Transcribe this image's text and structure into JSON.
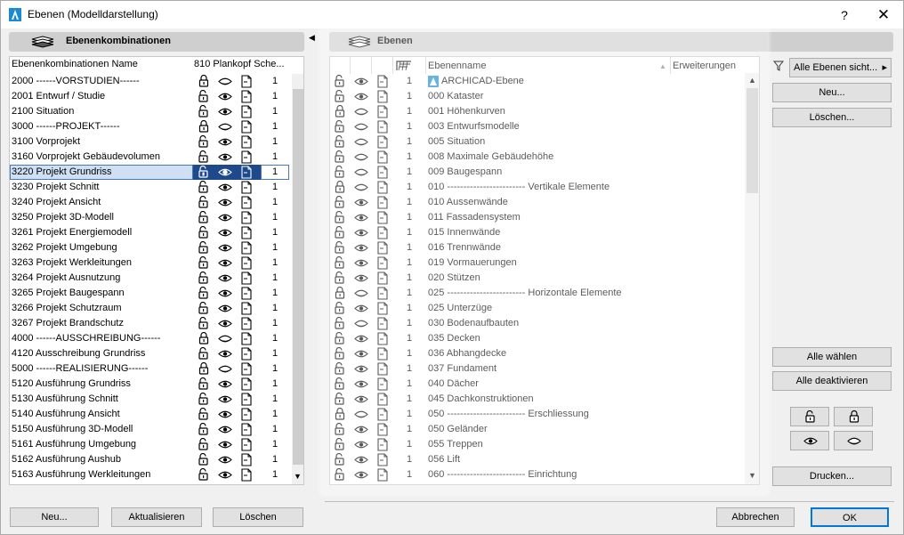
{
  "window": {
    "title": "Ebenen (Modelldarstellung)",
    "help_label": "?",
    "close_label": "✕"
  },
  "left": {
    "header": "Ebenenkombinationen",
    "col_name": "Ebenenkombinationen Name",
    "col_810": "810 Plankopf Sche...",
    "rows": [
      {
        "name": "2000 ------VORSTUDIEN------",
        "lock": "locked",
        "eye": "hidden",
        "count": "1"
      },
      {
        "name": "2001 Entwurf / Studie",
        "lock": "unlocked",
        "eye": "visible",
        "count": "1"
      },
      {
        "name": "2100 Situation",
        "lock": "unlocked",
        "eye": "visible",
        "count": "1"
      },
      {
        "name": "3000 ------PROJEKT------",
        "lock": "locked",
        "eye": "hidden",
        "count": "1"
      },
      {
        "name": "3100 Vorprojekt",
        "lock": "unlocked",
        "eye": "visible",
        "count": "1"
      },
      {
        "name": "3160 Vorprojekt Gebäudevolumen",
        "lock": "unlocked",
        "eye": "visible",
        "count": "1"
      },
      {
        "name": "3220 Projekt Grundriss",
        "lock": "unlocked",
        "eye": "visible",
        "count": "1",
        "selected": true
      },
      {
        "name": "3230 Projekt Schnitt",
        "lock": "unlocked",
        "eye": "visible",
        "count": "1"
      },
      {
        "name": "3240 Projekt Ansicht",
        "lock": "unlocked",
        "eye": "visible",
        "count": "1"
      },
      {
        "name": "3250 Projekt 3D-Modell",
        "lock": "unlocked",
        "eye": "visible",
        "count": "1"
      },
      {
        "name": "3261 Projekt Energiemodell",
        "lock": "unlocked",
        "eye": "visible",
        "count": "1"
      },
      {
        "name": "3262 Projekt Umgebung",
        "lock": "unlocked",
        "eye": "visible",
        "count": "1"
      },
      {
        "name": "3263 Projekt Werkleitungen",
        "lock": "unlocked",
        "eye": "visible",
        "count": "1"
      },
      {
        "name": "3264 Projekt Ausnutzung",
        "lock": "unlocked",
        "eye": "visible",
        "count": "1"
      },
      {
        "name": "3265 Projekt Baugespann",
        "lock": "unlocked",
        "eye": "visible",
        "count": "1"
      },
      {
        "name": "3266 Projekt Schutzraum",
        "lock": "unlocked",
        "eye": "visible",
        "count": "1"
      },
      {
        "name": "3267 Projekt Brandschutz",
        "lock": "unlocked",
        "eye": "visible",
        "count": "1"
      },
      {
        "name": "4000 ------AUSSCHREIBUNG------",
        "lock": "locked",
        "eye": "hidden",
        "count": "1"
      },
      {
        "name": "4120 Ausschreibung Grundriss",
        "lock": "unlocked",
        "eye": "visible",
        "count": "1"
      },
      {
        "name": "5000 ------REALISIERUNG------",
        "lock": "locked",
        "eye": "hidden",
        "count": "1"
      },
      {
        "name": "5120 Ausführung Grundriss",
        "lock": "unlocked",
        "eye": "visible",
        "count": "1"
      },
      {
        "name": "5130 Ausführung Schnitt",
        "lock": "unlocked",
        "eye": "visible",
        "count": "1"
      },
      {
        "name": "5140 Ausführung Ansicht",
        "lock": "unlocked",
        "eye": "visible",
        "count": "1"
      },
      {
        "name": "5150 Ausführung 3D-Modell",
        "lock": "unlocked",
        "eye": "visible",
        "count": "1"
      },
      {
        "name": "5161 Ausführung Umgebung",
        "lock": "unlocked",
        "eye": "visible",
        "count": "1"
      },
      {
        "name": "5162 Ausführung Aushub",
        "lock": "unlocked",
        "eye": "visible",
        "count": "1"
      },
      {
        "name": "5163 Ausführung Werkleitungen",
        "lock": "unlocked",
        "eye": "visible",
        "count": "1"
      }
    ],
    "btn_new": "Neu...",
    "btn_update": "Aktualisieren",
    "btn_delete": "Löschen"
  },
  "mid": {
    "header": "Ebenen",
    "col_name": "Ebenenname",
    "col_ext": "Erweiterungen",
    "rows": [
      {
        "name": "ARCHICAD-Ebene",
        "lock": "unlocked",
        "eye": "visible",
        "count": "1",
        "archicad": true
      },
      {
        "name": "000 Kataster",
        "lock": "unlocked",
        "eye": "visible",
        "count": "1"
      },
      {
        "name": "001 Höhenkurven",
        "lock": "locked",
        "eye": "hidden",
        "count": "1"
      },
      {
        "name": "003 Entwurfsmodelle",
        "lock": "unlocked",
        "eye": "hidden",
        "count": "1"
      },
      {
        "name": "005 Situation",
        "lock": "unlocked",
        "eye": "hidden",
        "count": "1"
      },
      {
        "name": "008 Maximale Gebäudehöhe",
        "lock": "unlocked",
        "eye": "hidden",
        "count": "1"
      },
      {
        "name": "009 Baugespann",
        "lock": "unlocked",
        "eye": "hidden",
        "count": "1"
      },
      {
        "name": "010 ------------------------ Vertikale Elemente",
        "lock": "locked",
        "eye": "hidden",
        "count": "1"
      },
      {
        "name": "010 Aussenwände",
        "lock": "unlocked",
        "eye": "visible",
        "count": "1"
      },
      {
        "name": "011 Fassadensystem",
        "lock": "unlocked",
        "eye": "visible",
        "count": "1"
      },
      {
        "name": "015 Innenwände",
        "lock": "unlocked",
        "eye": "visible",
        "count": "1"
      },
      {
        "name": "016 Trennwände",
        "lock": "unlocked",
        "eye": "visible",
        "count": "1"
      },
      {
        "name": "019 Vormauerungen",
        "lock": "unlocked",
        "eye": "visible",
        "count": "1"
      },
      {
        "name": "020 Stützen",
        "lock": "unlocked",
        "eye": "visible",
        "count": "1"
      },
      {
        "name": "025 ------------------------ Horizontale Elemente",
        "lock": "locked",
        "eye": "hidden",
        "count": "1"
      },
      {
        "name": "025 Unterzüge",
        "lock": "unlocked",
        "eye": "visible",
        "count": "1"
      },
      {
        "name": "030 Bodenaufbauten",
        "lock": "unlocked",
        "eye": "hidden",
        "count": "1"
      },
      {
        "name": "035 Decken",
        "lock": "unlocked",
        "eye": "visible",
        "count": "1"
      },
      {
        "name": "036 Abhangdecke",
        "lock": "unlocked",
        "eye": "visible",
        "count": "1"
      },
      {
        "name": "037 Fundament",
        "lock": "unlocked",
        "eye": "visible",
        "count": "1"
      },
      {
        "name": "040 Dächer",
        "lock": "unlocked",
        "eye": "visible",
        "count": "1"
      },
      {
        "name": "045 Dachkonstruktionen",
        "lock": "unlocked",
        "eye": "visible",
        "count": "1"
      },
      {
        "name": "050 ------------------------ Erschliessung",
        "lock": "locked",
        "eye": "hidden",
        "count": "1"
      },
      {
        "name": "050 Geländer",
        "lock": "unlocked",
        "eye": "visible",
        "count": "1"
      },
      {
        "name": "055 Treppen",
        "lock": "unlocked",
        "eye": "visible",
        "count": "1"
      },
      {
        "name": "056 Lift",
        "lock": "unlocked",
        "eye": "visible",
        "count": "1"
      },
      {
        "name": "060 ------------------------ Einrichtung",
        "lock": "unlocked",
        "eye": "visible",
        "count": "1"
      }
    ]
  },
  "right": {
    "filter_label": "Alle Ebenen sicht...",
    "btn_new": "Neu...",
    "btn_delete": "Löschen...",
    "btn_select_all": "Alle wählen",
    "btn_deselect_all": "Alle deaktivieren",
    "btn_print": "Drucken..."
  },
  "footer": {
    "btn_cancel": "Abbrechen",
    "btn_ok": "OK"
  }
}
